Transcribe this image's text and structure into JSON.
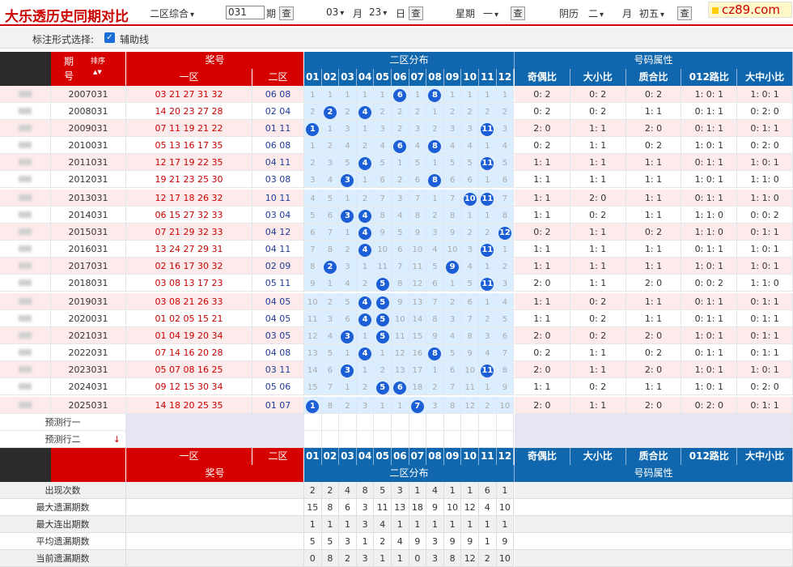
{
  "header": {
    "title": "大乐透历史同期对比",
    "zone_select": "二区综合",
    "period_value": "031",
    "period_label": "期",
    "month_value": "03",
    "month_label": "月",
    "day_value": "23",
    "day_label": "日",
    "week_label": "星期",
    "week_value": "一",
    "lunar_label": "阴历",
    "lunar_month": "二",
    "lunar_month_label": "月",
    "lunar_day": "初五",
    "check_label": "查",
    "logo": "cz89.com"
  },
  "options": {
    "label": "标注形式选择:",
    "aux_line": "辅助线",
    "checkmark": "✓"
  },
  "table_header": {
    "issue_label": "期",
    "issue_label2": "号",
    "sort_label": "排序",
    "prize_label": "奖号",
    "zone1": "一区",
    "zone2": "二区",
    "dist_label": "二区分布",
    "attr_label": "号码属性",
    "dist_cols": [
      "01",
      "02",
      "03",
      "04",
      "05",
      "06",
      "07",
      "08",
      "09",
      "10",
      "11",
      "12"
    ],
    "attr_cols": [
      "奇偶比",
      "大小比",
      "质合比",
      "012路比",
      "大中小比"
    ]
  },
  "rows": [
    {
      "issue": "2007031",
      "z1": "03 21 27 31 32",
      "z2": "06 08",
      "dist": [
        "1",
        "1",
        "1",
        "1",
        "1",
        "6",
        "1",
        "8",
        "1",
        "1",
        "1",
        "1"
      ],
      "hits": [
        6,
        8
      ],
      "attrs": [
        "0: 2",
        "0: 2",
        "0: 2",
        "1: 0: 1",
        "1: 0: 1"
      ]
    },
    {
      "issue": "2008031",
      "z1": "14 20 23 27 28",
      "z2": "02 04",
      "dist": [
        "2",
        "2",
        "2",
        "4",
        "2",
        "2",
        "2",
        "1",
        "2",
        "2",
        "2",
        "2"
      ],
      "hits": [
        2,
        4
      ],
      "attrs": [
        "0: 2",
        "0: 2",
        "1: 1",
        "0: 1: 1",
        "0: 2: 0"
      ]
    },
    {
      "issue": "2009031",
      "z1": "07 11 19 21 22",
      "z2": "01 11",
      "dist": [
        "1",
        "1",
        "3",
        "1",
        "3",
        "2",
        "3",
        "2",
        "3",
        "3",
        "11",
        "3"
      ],
      "hits": [
        1,
        11
      ],
      "attrs": [
        "2: 0",
        "1: 1",
        "2: 0",
        "0: 1: 1",
        "0: 1: 1"
      ]
    },
    {
      "issue": "2010031",
      "z1": "05 13 16 17 35",
      "z2": "06 08",
      "dist": [
        "1",
        "2",
        "4",
        "2",
        "4",
        "6",
        "4",
        "8",
        "4",
        "4",
        "1",
        "4"
      ],
      "hits": [
        6,
        8
      ],
      "attrs": [
        "0: 2",
        "1: 1",
        "0: 2",
        "1: 0: 1",
        "0: 2: 0"
      ]
    },
    {
      "issue": "2011031",
      "z1": "12 17 19 22 35",
      "z2": "04 11",
      "dist": [
        "2",
        "3",
        "5",
        "4",
        "5",
        "1",
        "5",
        "1",
        "5",
        "5",
        "11",
        "5"
      ],
      "hits": [
        4,
        11
      ],
      "attrs": [
        "1: 1",
        "1: 1",
        "1: 1",
        "0: 1: 1",
        "1: 0: 1"
      ]
    },
    {
      "issue": "2012031",
      "z1": "19 21 23 25 30",
      "z2": "03 08",
      "dist": [
        "3",
        "4",
        "3",
        "1",
        "6",
        "2",
        "6",
        "8",
        "6",
        "6",
        "1",
        "6"
      ],
      "hits": [
        3,
        8
      ],
      "attrs": [
        "1: 1",
        "1: 1",
        "1: 1",
        "1: 0: 1",
        "1: 1: 0"
      ]
    },
    {
      "issue": "2013031",
      "z1": "12 17 18 26 32",
      "z2": "10 11",
      "dist": [
        "4",
        "5",
        "1",
        "2",
        "7",
        "3",
        "7",
        "1",
        "7",
        "10",
        "11",
        "7"
      ],
      "hits": [
        10,
        11
      ],
      "attrs": [
        "1: 1",
        "2: 0",
        "1: 1",
        "0: 1: 1",
        "1: 1: 0"
      ]
    },
    {
      "issue": "2014031",
      "z1": "06 15 27 32 33",
      "z2": "03 04",
      "dist": [
        "5",
        "6",
        "3",
        "4",
        "8",
        "4",
        "8",
        "2",
        "8",
        "1",
        "1",
        "8"
      ],
      "hits": [
        3,
        4
      ],
      "attrs": [
        "1: 1",
        "0: 2",
        "1: 1",
        "1: 1: 0",
        "0: 0: 2"
      ]
    },
    {
      "issue": "2015031",
      "z1": "07 21 29 32 33",
      "z2": "04 12",
      "dist": [
        "6",
        "7",
        "1",
        "4",
        "9",
        "5",
        "9",
        "3",
        "9",
        "2",
        "2",
        "12"
      ],
      "hits": [
        4,
        12
      ],
      "attrs": [
        "0: 2",
        "1: 1",
        "0: 2",
        "1: 1: 0",
        "0: 1: 1"
      ]
    },
    {
      "issue": "2016031",
      "z1": "13 24 27 29 31",
      "z2": "04 11",
      "dist": [
        "7",
        "8",
        "2",
        "4",
        "10",
        "6",
        "10",
        "4",
        "10",
        "3",
        "11",
        "1"
      ],
      "hits": [
        4,
        11
      ],
      "attrs": [
        "1: 1",
        "1: 1",
        "1: 1",
        "0: 1: 1",
        "1: 0: 1"
      ]
    },
    {
      "issue": "2017031",
      "z1": "02 16 17 30 32",
      "z2": "02 09",
      "dist": [
        "8",
        "2",
        "3",
        "1",
        "11",
        "7",
        "11",
        "5",
        "9",
        "4",
        "1",
        "2"
      ],
      "hits": [
        2,
        9
      ],
      "attrs": [
        "1: 1",
        "1: 1",
        "1: 1",
        "1: 0: 1",
        "1: 0: 1"
      ]
    },
    {
      "issue": "2018031",
      "z1": "03 08 13 17 23",
      "z2": "05 11",
      "dist": [
        "9",
        "1",
        "4",
        "2",
        "5",
        "8",
        "12",
        "6",
        "1",
        "5",
        "11",
        "3"
      ],
      "hits": [
        5,
        11
      ],
      "attrs": [
        "2: 0",
        "1: 1",
        "2: 0",
        "0: 0: 2",
        "1: 1: 0"
      ]
    },
    {
      "issue": "2019031",
      "z1": "03 08 21 26 33",
      "z2": "04 05",
      "dist": [
        "10",
        "2",
        "5",
        "4",
        "5",
        "9",
        "13",
        "7",
        "2",
        "6",
        "1",
        "4"
      ],
      "hits": [
        4,
        5
      ],
      "attrs": [
        "1: 1",
        "0: 2",
        "1: 1",
        "0: 1: 1",
        "0: 1: 1"
      ]
    },
    {
      "issue": "2020031",
      "z1": "01 02 05 15 21",
      "z2": "04 05",
      "dist": [
        "11",
        "3",
        "6",
        "4",
        "5",
        "10",
        "14",
        "8",
        "3",
        "7",
        "2",
        "5"
      ],
      "hits": [
        4,
        5
      ],
      "attrs": [
        "1: 1",
        "0: 2",
        "1: 1",
        "0: 1: 1",
        "0: 1: 1"
      ]
    },
    {
      "issue": "2021031",
      "z1": "01 04 19 20 34",
      "z2": "03 05",
      "dist": [
        "12",
        "4",
        "3",
        "1",
        "5",
        "11",
        "15",
        "9",
        "4",
        "8",
        "3",
        "6"
      ],
      "hits": [
        3,
        5
      ],
      "attrs": [
        "2: 0",
        "0: 2",
        "2: 0",
        "1: 0: 1",
        "0: 1: 1"
      ]
    },
    {
      "issue": "2022031",
      "z1": "07 14 16 20 28",
      "z2": "04 08",
      "dist": [
        "13",
        "5",
        "1",
        "4",
        "1",
        "12",
        "16",
        "8",
        "5",
        "9",
        "4",
        "7"
      ],
      "hits": [
        4,
        8
      ],
      "attrs": [
        "0: 2",
        "1: 1",
        "0: 2",
        "0: 1: 1",
        "0: 1: 1"
      ]
    },
    {
      "issue": "2023031",
      "z1": "05 07 08 16 25",
      "z2": "03 11",
      "dist": [
        "14",
        "6",
        "3",
        "1",
        "2",
        "13",
        "17",
        "1",
        "6",
        "10",
        "11",
        "8"
      ],
      "hits": [
        3,
        11
      ],
      "attrs": [
        "2: 0",
        "1: 1",
        "2: 0",
        "1: 0: 1",
        "1: 0: 1"
      ]
    },
    {
      "issue": "2024031",
      "z1": "09 12 15 30 34",
      "z2": "05 06",
      "dist": [
        "15",
        "7",
        "1",
        "2",
        "5",
        "6",
        "18",
        "2",
        "7",
        "11",
        "1",
        "9"
      ],
      "hits": [
        5,
        6
      ],
      "attrs": [
        "1: 1",
        "0: 2",
        "1: 1",
        "1: 0: 1",
        "0: 2: 0"
      ]
    },
    {
      "issue": "2025031",
      "z1": "14 18 20 25 35",
      "z2": "01 07",
      "dist": [
        "1",
        "8",
        "2",
        "3",
        "1",
        "1",
        "7",
        "3",
        "8",
        "12",
        "2",
        "10"
      ],
      "hits": [
        1,
        7
      ],
      "attrs": [
        "2: 0",
        "1: 1",
        "2: 0",
        "0: 2: 0",
        "0: 1: 1"
      ]
    }
  ],
  "predict": [
    "预测行一",
    "预测行二"
  ],
  "predict_arrow": "↓",
  "stats": [
    {
      "label": "出现次数",
      "vals": [
        "2",
        "2",
        "4",
        "8",
        "5",
        "3",
        "1",
        "4",
        "1",
        "1",
        "6",
        "1"
      ]
    },
    {
      "label": "最大遗漏期数",
      "vals": [
        "15",
        "8",
        "6",
        "3",
        "11",
        "13",
        "18",
        "9",
        "10",
        "12",
        "4",
        "10"
      ]
    },
    {
      "label": "最大连出期数",
      "vals": [
        "1",
        "1",
        "1",
        "3",
        "4",
        "1",
        "1",
        "1",
        "1",
        "1",
        "1",
        "1"
      ]
    },
    {
      "label": "平均遗漏期数",
      "vals": [
        "5",
        "5",
        "3",
        "1",
        "2",
        "4",
        "9",
        "3",
        "9",
        "9",
        "1",
        "9"
      ]
    },
    {
      "label": "当前遗漏期数",
      "vals": [
        "0",
        "8",
        "2",
        "3",
        "1",
        "1",
        "0",
        "3",
        "8",
        "12",
        "2",
        "10"
      ]
    }
  ]
}
